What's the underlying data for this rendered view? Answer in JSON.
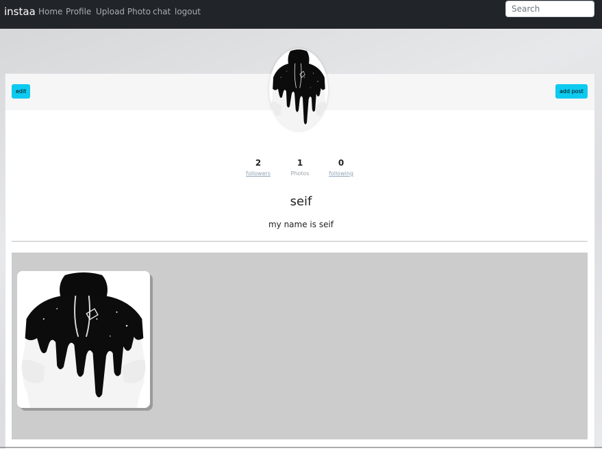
{
  "navbar": {
    "brand": "instaa",
    "links": [
      "Home",
      "Profile",
      "Upload Photo",
      "chat",
      "logout"
    ],
    "search_placeholder": "Search"
  },
  "profile": {
    "edit_label": "edit",
    "add_post_label": "add post",
    "stats": [
      {
        "value": "2",
        "label": "followers"
      },
      {
        "value": "1",
        "label": "Photos"
      },
      {
        "value": "0",
        "label": "following"
      }
    ],
    "username": "seif",
    "bio": "my name is seif"
  },
  "colors": {
    "navbar": "#212529",
    "accent_button": "#0dcaf0",
    "gallery_bg": "#cccccc"
  },
  "icons": {
    "avatar": "hoodie-image",
    "post": "hoodie-image"
  }
}
